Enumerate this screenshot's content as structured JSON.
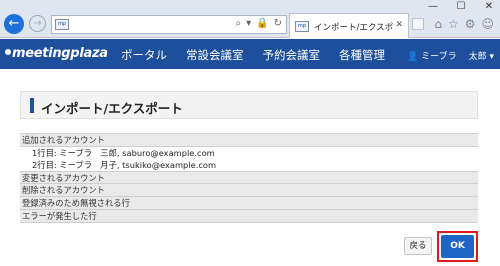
{
  "browser": {
    "window_controls": [
      "—",
      "☐",
      "✕"
    ],
    "favicon_text": "mp",
    "tab_title": "インポート/エクスポート",
    "tab_close": "✕",
    "address_icons": [
      "⌕",
      "▾",
      "🔒",
      "↻"
    ],
    "tool_icons": [
      "⌂",
      "☆",
      "⚙",
      "☺"
    ]
  },
  "app": {
    "logo": "meetingplaza",
    "nav": [
      "ポータル",
      "常設会議室",
      "予約会議室",
      "各種管理"
    ],
    "user_menu": "ミーブラ",
    "user_name_menu": "太郎 ▾"
  },
  "page": {
    "title": "インポート/エクスポート",
    "sections": {
      "added": {
        "label": "追加されるアカウント",
        "rows": [
          "1行目: ミーブラ　三郎, saburo@example.com",
          "2行目: ミーブラ　月子, tsukiko@example.com"
        ]
      },
      "changed": {
        "label": "変更されるアカウント"
      },
      "deleted": {
        "label": "削除されるアカウント"
      },
      "ignored": {
        "label": "登録済みのため無視される行"
      },
      "errors": {
        "label": "エラーが発生した行"
      }
    },
    "buttons": {
      "back": "戻る",
      "ok": "OK"
    }
  },
  "colors": {
    "brand": "#1d4f9c",
    "ok_button": "#1e66c8",
    "highlight": "#e01b1b"
  }
}
